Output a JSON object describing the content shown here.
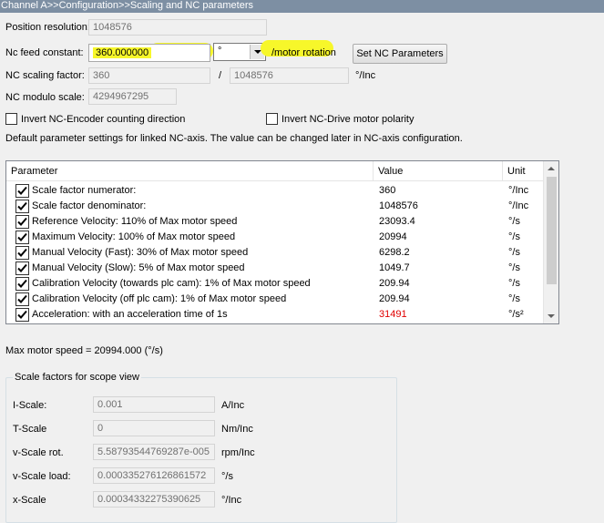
{
  "window": {
    "title": "Channel A>>Configuration>>Scaling and NC parameters"
  },
  "position_resolution": {
    "label": "Position resolution:",
    "value": "1048576"
  },
  "nc_feed_constant": {
    "label": "Nc feed constant:",
    "value": "360.000000",
    "unit_selected": "°",
    "suffix": "/motor rotation"
  },
  "set_nc_button": {
    "label": "Set NC Parameters"
  },
  "nc_scaling_factor": {
    "label": "NC scaling factor:",
    "numerator": "360",
    "separator": "/",
    "denominator": "1048576",
    "unit": "°/Inc"
  },
  "nc_modulo_scale": {
    "label": "NC modulo scale:",
    "value": "4294967295"
  },
  "checkboxes": {
    "invert_encoder": {
      "label": "Invert NC-Encoder counting direction",
      "checked": false
    },
    "invert_drive": {
      "label": "Invert NC-Drive motor polarity",
      "checked": false
    }
  },
  "info_text": "Default parameter settings for linked NC-axis. The value can be changed later in NC-axis configuration.",
  "param_table": {
    "headers": [
      "Parameter",
      "Value",
      "Unit"
    ],
    "rows": [
      {
        "checked": true,
        "parameter": "Scale factor numerator:",
        "value": "360",
        "unit": "°/Inc",
        "highlight": false
      },
      {
        "checked": true,
        "parameter": "Scale factor denominator:",
        "value": "1048576",
        "unit": "°/Inc",
        "highlight": false
      },
      {
        "checked": true,
        "parameter": "Reference Velocity: 110% of Max motor speed",
        "value": "23093.4",
        "unit": "°/s",
        "highlight": false
      },
      {
        "checked": true,
        "parameter": "Maximum Velocity: 100% of Max motor speed",
        "value": "20994",
        "unit": "°/s",
        "highlight": false
      },
      {
        "checked": true,
        "parameter": "Manual Velocity (Fast): 30% of Max motor speed",
        "value": "6298.2",
        "unit": "°/s",
        "highlight": false
      },
      {
        "checked": true,
        "parameter": "Manual Velocity (Slow): 5% of Max motor speed",
        "value": "1049.7",
        "unit": "°/s",
        "highlight": false
      },
      {
        "checked": true,
        "parameter": "Calibration Velocity (towards plc cam): 1% of Max motor speed",
        "value": "209.94",
        "unit": "°/s",
        "highlight": false
      },
      {
        "checked": true,
        "parameter": "Calibration Velocity (off plc cam): 1% of Max motor speed",
        "value": "209.94",
        "unit": "°/s",
        "highlight": false
      },
      {
        "checked": true,
        "parameter": "Acceleration: with an acceleration time of 1s",
        "value": "31491",
        "unit": "°/s²",
        "highlight": true
      }
    ]
  },
  "max_motor_speed": "Max motor speed = 20994.000 (°/s)",
  "scope_view": {
    "title": "Scale factors for scope view",
    "rows": [
      {
        "label": "I-Scale:",
        "value": "0.001",
        "unit": "A/Inc"
      },
      {
        "label": "T-Scale",
        "value": "0",
        "unit": "Nm/Inc"
      },
      {
        "label": "v-Scale rot.",
        "value": "5.58793544769287e-005",
        "unit": "rpm/Inc"
      },
      {
        "label": "v-Scale load:",
        "value": "0.000335276126861572",
        "unit": "°/s"
      },
      {
        "label": "x-Scale",
        "value": "0.00034332275390625",
        "unit": "°/Inc"
      }
    ]
  },
  "colors": {
    "highlight": "#f7f72a",
    "warning_value": "#e00000",
    "titlebar": "#7d8fa3"
  }
}
